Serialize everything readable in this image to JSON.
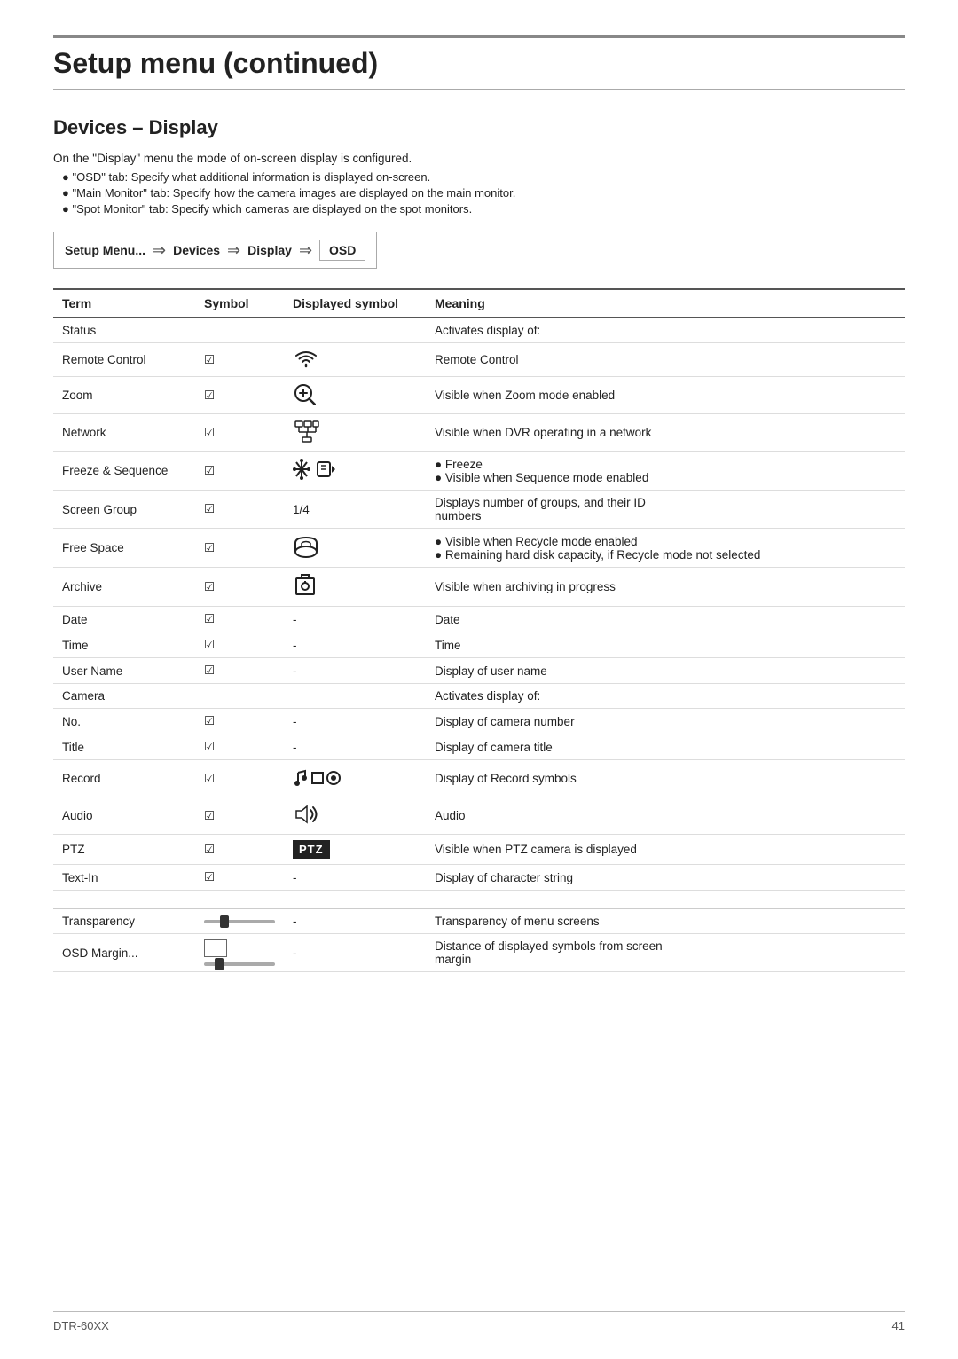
{
  "page": {
    "title": "Setup menu (continued)",
    "section_title": "Devices – Display",
    "intro": "On the \"Display\" menu the mode of on-screen display is configured.",
    "bullets": [
      "\"OSD\" tab: Specify what additional information is displayed on-screen.",
      "\"Main Monitor\" tab: Specify how the camera images are displayed on the main monitor.",
      "\"Spot Monitor\" tab: Specify which cameras are displayed on the spot monitors."
    ]
  },
  "breadcrumb": {
    "setup_menu": "Setup Menu...",
    "devices": "Devices",
    "display": "Display",
    "osd": "OSD"
  },
  "table": {
    "headers": {
      "term": "Term",
      "symbol": "Symbol",
      "displayed_symbol": "Displayed symbol",
      "meaning": "Meaning"
    },
    "rows": [
      {
        "term": "Status",
        "symbol": "",
        "displayed": "",
        "meaning": "Activates display of:",
        "section": true
      },
      {
        "term": "Remote Control",
        "symbol": "✓",
        "displayed": "wifi",
        "meaning": "Remote Control"
      },
      {
        "term": "Zoom",
        "symbol": "✓",
        "displayed": "zoom",
        "meaning": "Visible when Zoom mode enabled"
      },
      {
        "term": "Network",
        "symbol": "✓",
        "displayed": "network",
        "meaning": "Visible when DVR operating in a network"
      },
      {
        "term": "Freeze & Sequence",
        "symbol": "✓",
        "displayed": "freeze_seq",
        "meaning_bullets": [
          "Freeze",
          "Visible when Sequence mode enabled"
        ]
      },
      {
        "term": "Screen Group",
        "symbol": "✓",
        "displayed": "1/4",
        "meaning_lines": [
          "Displays number of groups, and their ID",
          "numbers"
        ]
      },
      {
        "term": "Free Space",
        "symbol": "✓",
        "displayed": "freespace",
        "meaning_bullets": [
          "Visible when Recycle mode enabled",
          "Remaining hard disk capacity, if Recycle mode not selected"
        ]
      },
      {
        "term": "Archive",
        "symbol": "✓",
        "displayed": "archive",
        "meaning": "Visible when archiving in progress"
      },
      {
        "term": "Date",
        "symbol": "✓",
        "displayed": "-",
        "meaning": "Date"
      },
      {
        "term": "Time",
        "symbol": "✓",
        "displayed": "-",
        "meaning": "Time"
      },
      {
        "term": "User Name",
        "symbol": "✓",
        "displayed": "-",
        "meaning": "Display of user name"
      },
      {
        "term": "Camera",
        "symbol": "",
        "displayed": "",
        "meaning": "Activates display of:",
        "section": true
      },
      {
        "term": "No.",
        "symbol": "✓",
        "displayed": "-",
        "meaning": "Display of camera number"
      },
      {
        "term": "Title",
        "symbol": "✓",
        "displayed": "-",
        "meaning": "Display of camera title"
      },
      {
        "term": "Record",
        "symbol": "✓",
        "displayed": "record",
        "meaning": "Display of Record symbols"
      },
      {
        "term": "Audio",
        "symbol": "✓",
        "displayed": "audio",
        "meaning": "Audio"
      },
      {
        "term": "PTZ",
        "symbol": "✓",
        "displayed": "ptz",
        "meaning": "Visible when PTZ camera is displayed"
      },
      {
        "term": "Text-In",
        "symbol": "✓",
        "displayed": "-",
        "meaning": "Display of character string"
      }
    ]
  },
  "footer_rows": [
    {
      "term": "Transparency",
      "displayed": "-",
      "meaning": "Transparency of menu screens"
    },
    {
      "term": "OSD Margin...",
      "displayed": "-",
      "meaning_lines": [
        "Distance of displayed symbols from screen",
        "margin"
      ]
    }
  ],
  "page_footer": {
    "left": "DTR-60XX",
    "right": "41"
  }
}
